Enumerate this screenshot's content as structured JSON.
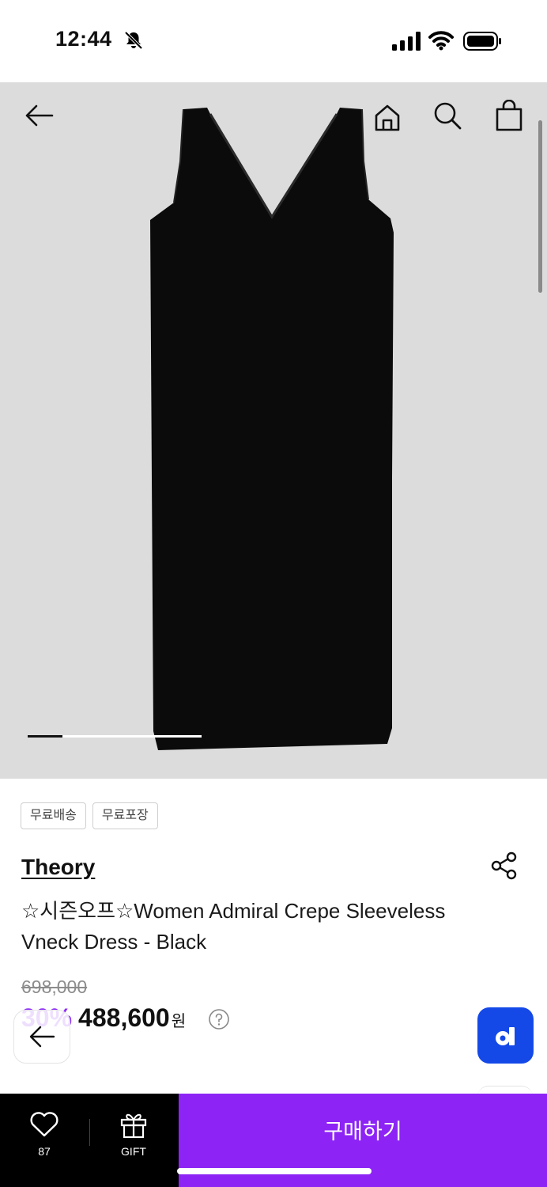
{
  "status_bar": {
    "time": "12:44"
  },
  "header": {
    "icons": [
      "back-arrow-icon",
      "home-icon",
      "search-icon",
      "shopping-bag-icon"
    ]
  },
  "gallery": {
    "current_image": 1,
    "progress": 0.2
  },
  "tags": [
    "무료배송",
    "무료포장"
  ],
  "product": {
    "brand": "Theory",
    "title": "☆시즌오프☆Women Admiral Crepe Sleeveless Vneck Dress - Black",
    "original_price": "698,000",
    "discount": "30%",
    "price": "488,600",
    "currency": "원"
  },
  "bottom_bar": {
    "like_count": "87",
    "gift_label": "GIFT",
    "buy_label": "구매하기"
  },
  "colors": {
    "accent": "#8d24f5",
    "discount": "#8c2cf7",
    "badge": "#1449e8",
    "hero_bg": "#dcdcdc"
  }
}
